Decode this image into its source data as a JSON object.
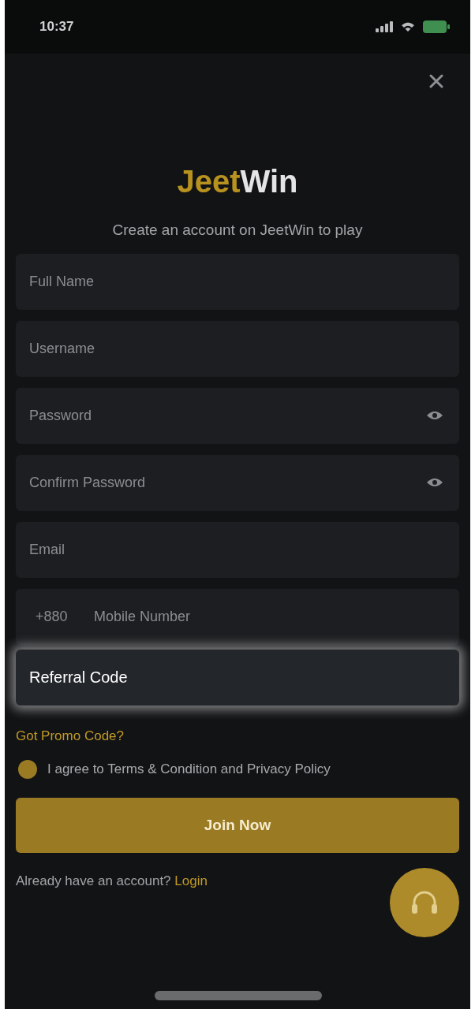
{
  "status_bar": {
    "time": "10:37"
  },
  "logo": [
    {
      "text": "Jeet",
      "color": "#b8921f"
    },
    {
      "text": "Win",
      "color": "#e4e4e4"
    }
  ],
  "subtitle": "Create an account on JeetWin to play",
  "fields": [
    {
      "kind": "text",
      "placeholder": "Full Name",
      "highlighted": false
    },
    {
      "kind": "text",
      "placeholder": "Username",
      "highlighted": false
    },
    {
      "kind": "password",
      "placeholder": "Password",
      "highlighted": false
    },
    {
      "kind": "password",
      "placeholder": "Confirm Password",
      "highlighted": false
    },
    {
      "kind": "text",
      "placeholder": "Email",
      "highlighted": false
    },
    {
      "kind": "phone",
      "country_code": "+880",
      "placeholder": "Mobile Number",
      "highlighted": false
    },
    {
      "kind": "text",
      "placeholder": "Referral Code",
      "highlighted": true
    }
  ],
  "promo_link": "Got Promo Code?",
  "agreement": {
    "checked": true,
    "text": "I agree to Terms & Condition and Privacy Policy"
  },
  "submit_button": "Join Now",
  "login_prompt": {
    "text": "Already have an account?",
    "link": "Login"
  }
}
